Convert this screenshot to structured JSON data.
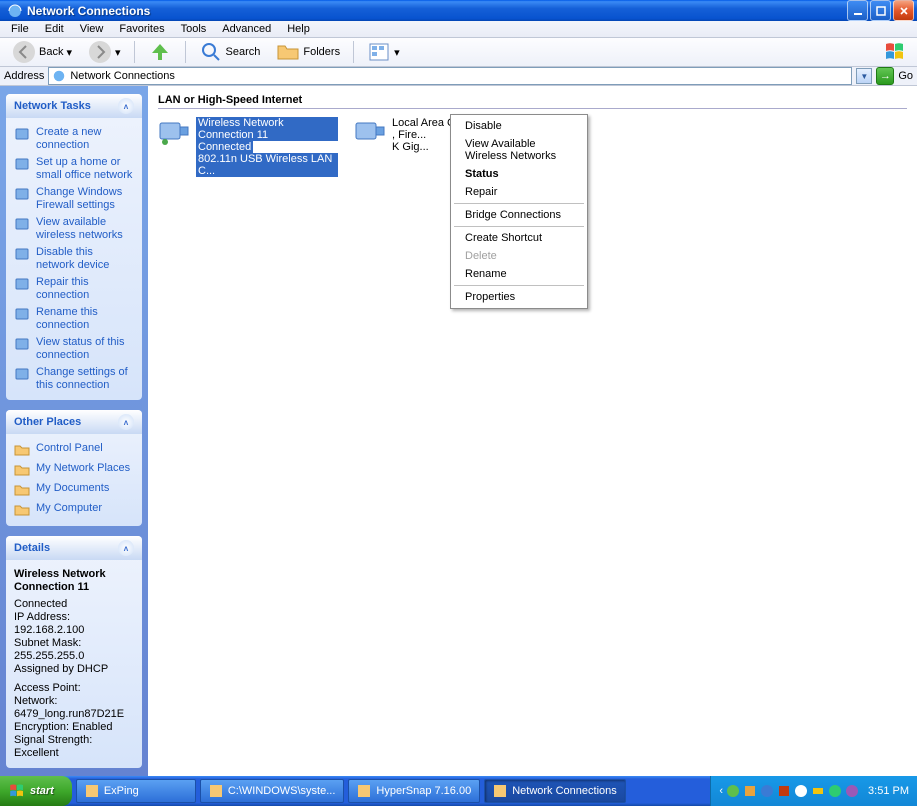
{
  "window": {
    "title": "Network Connections"
  },
  "menu": [
    "File",
    "Edit",
    "View",
    "Favorites",
    "Tools",
    "Advanced",
    "Help"
  ],
  "toolbar": {
    "back": "Back",
    "search": "Search",
    "folders": "Folders"
  },
  "address": {
    "label": "Address",
    "value": "Network Connections",
    "go": "Go"
  },
  "sidebar": {
    "tasks": {
      "title": "Network Tasks",
      "items": [
        "Create a new connection",
        "Set up a home or small office network",
        "Change Windows Firewall settings",
        "View available wireless networks",
        "Disable this network device",
        "Repair this connection",
        "Rename this connection",
        "View status of this connection",
        "Change settings of this connection"
      ]
    },
    "places": {
      "title": "Other Places",
      "items": [
        "Control Panel",
        "My Network Places",
        "My Documents",
        "My Computer"
      ]
    },
    "details": {
      "title": "Details",
      "name": "Wireless Network Connection 11",
      "state": "Connected",
      "ip": "IP Address: 192.168.2.100",
      "mask": "Subnet Mask: 255.255.255.0",
      "dhcp": "Assigned by DHCP",
      "ap": "Access Point:",
      "net": "Network: 6479_long.run87D21E",
      "enc": "Encryption: Enabled",
      "sig": "Signal Strength: Excellent"
    }
  },
  "content": {
    "group": "LAN or High-Speed Internet",
    "conn1": {
      "name": "Wireless Network Connection 11",
      "state": "Connected",
      "dev": "802.11n USB Wireless LAN C..."
    },
    "conn2": {
      "name": "Local Area Connection",
      "state": ", Fire...",
      "dev": "K Gig..."
    }
  },
  "context_menu": [
    {
      "t": "item",
      "label": "Disable"
    },
    {
      "t": "item",
      "label": "View Available Wireless Networks"
    },
    {
      "t": "item",
      "label": "Status",
      "bold": true
    },
    {
      "t": "item",
      "label": "Repair"
    },
    {
      "t": "sep"
    },
    {
      "t": "item",
      "label": "Bridge Connections"
    },
    {
      "t": "sep"
    },
    {
      "t": "item",
      "label": "Create Shortcut"
    },
    {
      "t": "item",
      "label": "Delete",
      "disabled": true
    },
    {
      "t": "item",
      "label": "Rename"
    },
    {
      "t": "sep"
    },
    {
      "t": "item",
      "label": "Properties"
    }
  ],
  "taskbar": {
    "start": "start",
    "items": [
      {
        "label": "ExPing"
      },
      {
        "label": "C:\\WINDOWS\\syste..."
      },
      {
        "label": "HyperSnap 7.16.00"
      },
      {
        "label": "Network Connections",
        "active": true
      }
    ],
    "clock": "3:51 PM"
  }
}
